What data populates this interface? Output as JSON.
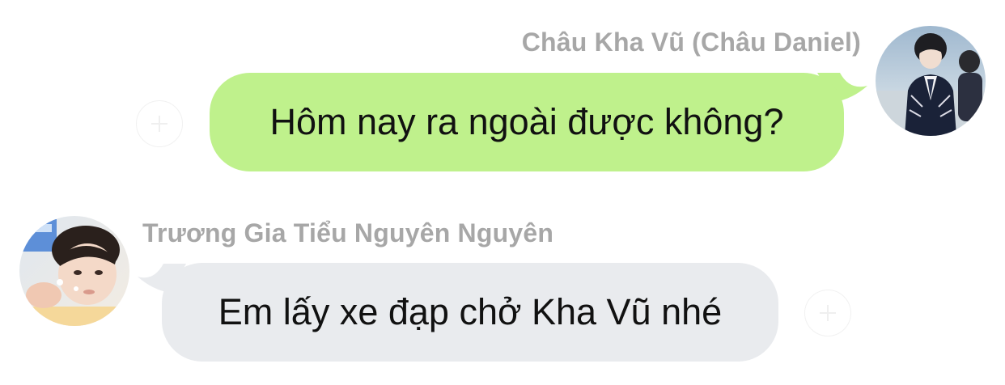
{
  "messages": [
    {
      "direction": "outgoing",
      "sender": "Châu Kha Vũ (Châu Daniel)",
      "text": "Hôm nay ra ngoài được không?",
      "bubble_color": "#bff18c",
      "avatar_icon": "avatar-photo"
    },
    {
      "direction": "incoming",
      "sender": "Trương Gia Tiểu Nguyên Nguyên",
      "text": "Em lấy xe đạp chở Kha Vũ nhé",
      "bubble_color": "#e9ebee",
      "avatar_icon": "avatar-photo"
    }
  ],
  "colors": {
    "sender_name": "#a7a7a7",
    "text": "#111111",
    "background": "#ffffff"
  },
  "icons": {
    "reaction": "add-reaction-icon"
  }
}
